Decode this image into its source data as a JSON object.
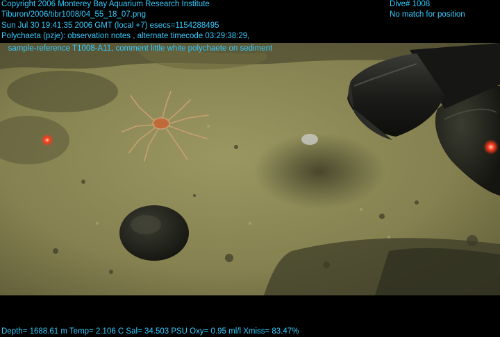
{
  "overlay": {
    "text_color": "#33CCFF",
    "copyright": "Copyright 2006 Monterey Bay Aquarium Research Institute",
    "file_path": "Tiburon/2006/tibr1008/04_55_18_07.png",
    "datetime": "Sun Jul 30 19:41:35 2006 GMT (local +7)  esecs=1154288495",
    "observation": "Polychaeta (pzje): observation notes , alternate timecode 03:29:38:29,",
    "sample": "   sample-reference T1008-A11, comment little white polychaete on sediment",
    "dive": "Dive# 1008",
    "position_status": "No match for position",
    "sensors": "Depth= 1688.61 m  Temp= 2.106 C  Sal= 34.503 PSU  Oxy= 0.95 ml/l  Xmiss= 83.47%"
  },
  "scene": {
    "sediment_color": "#8E8A55",
    "shadow_color": "#3A3A22",
    "rock_color": "#2A2B22",
    "crab_color": "#C8A070",
    "laser_color": "#FF3A1A",
    "sampler_color": "#1E1F1C"
  }
}
